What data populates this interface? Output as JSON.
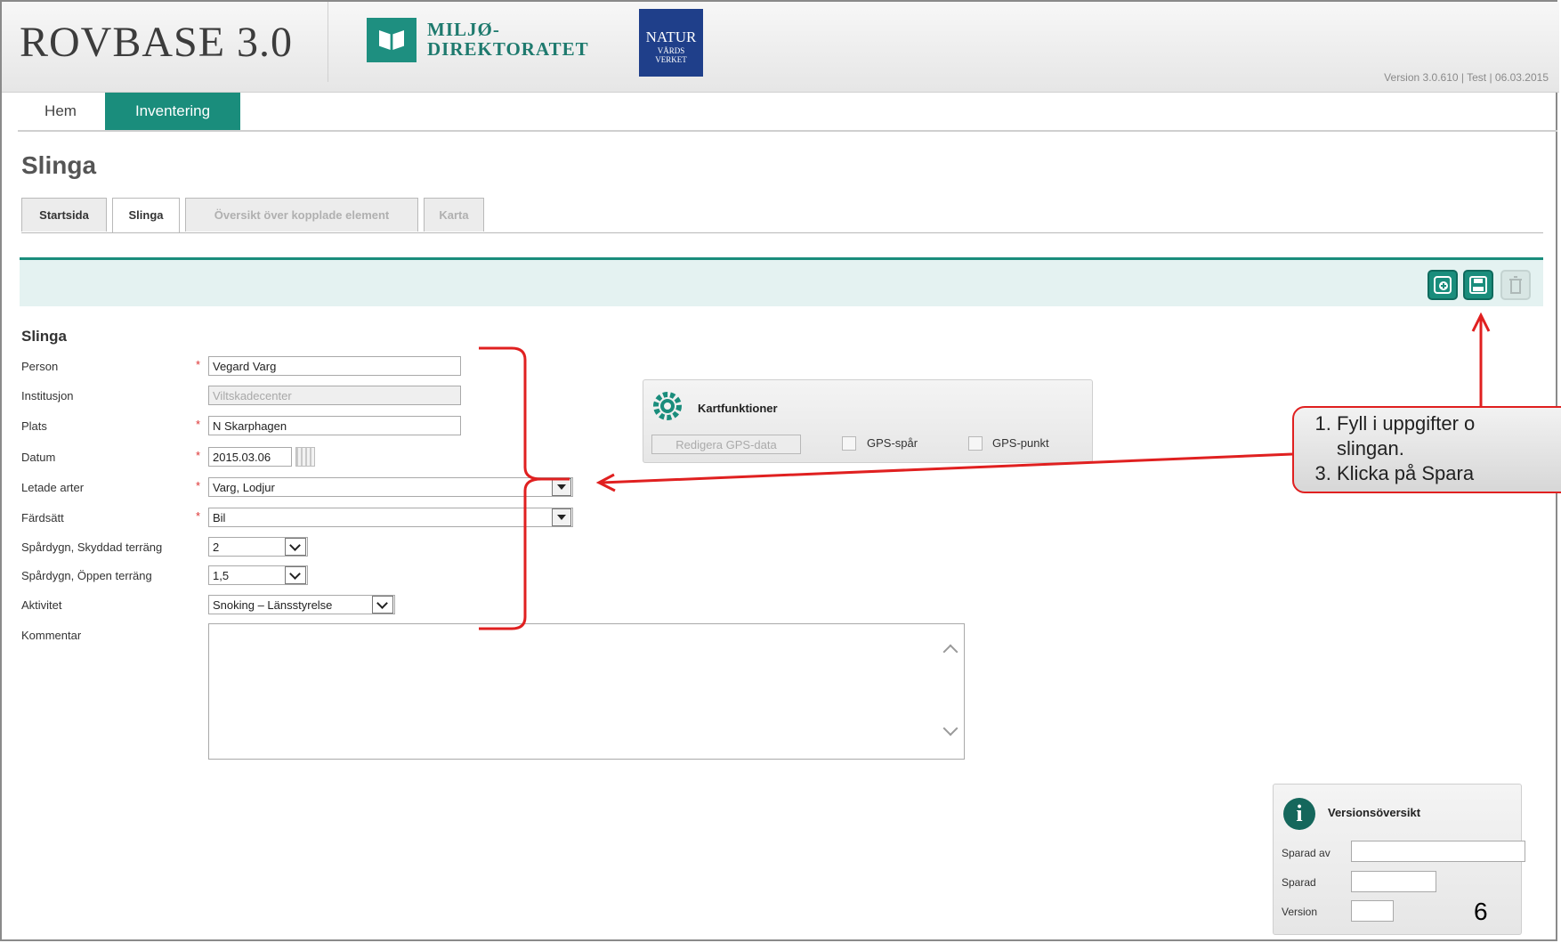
{
  "app": {
    "title": "ROVBASE 3.0",
    "logo_miljo_line1": "MILJØ-",
    "logo_miljo_line2": "DIREKTORATET",
    "logo_nv_line1": "NATUR",
    "logo_nv_line2": "VÅRDS",
    "logo_nv_line3": "VERKET",
    "version_info": "Version 3.0.610 | Test | 06.03.2015"
  },
  "nav": {
    "home": "Hem",
    "inventory": "Inventering"
  },
  "page": {
    "title": "Slinga"
  },
  "tabs": [
    {
      "label": "Startsida",
      "state": "normal"
    },
    {
      "label": "Slinga",
      "state": "active"
    },
    {
      "label": "Översikt över kopplade element",
      "state": "disabled"
    },
    {
      "label": "Karta",
      "state": "disabled"
    }
  ],
  "toolbar": {
    "icons": [
      "new-icon",
      "save-icon",
      "delete-icon"
    ]
  },
  "form": {
    "section_title": "Slinga",
    "required_mark": "*",
    "person_label": "Person",
    "person_value": "Vegard Varg",
    "institution_label": "Institusjon",
    "institution_value": "Viltskadecenter",
    "plats_label": "Plats",
    "plats_value": "N Skarphagen",
    "datum_label": "Datum",
    "datum_value": "2015.03.06",
    "arter_label": "Letade arter",
    "arter_value": "Varg, Lodjur",
    "fardsatt_label": "Färdsätt",
    "fardsatt_value": "Bil",
    "skyddad_label": "Spårdygn, Skyddad terräng",
    "skyddad_value": "2",
    "oppen_label": "Spårdygn, Öppen terräng",
    "oppen_value": "1,5",
    "aktivitet_label": "Aktivitet",
    "aktivitet_value": "Snoking – Länsstyrelse",
    "kommentar_label": "Kommentar",
    "kommentar_value": ""
  },
  "kartfunktioner": {
    "title": "Kartfunktioner",
    "edit_gps_button": "Redigera GPS-data",
    "gps_spar_label": "GPS-spår",
    "gps_punkt_label": "GPS-punkt"
  },
  "versionsoversikt": {
    "title": "Versionsöversikt",
    "sparad_av_label": "Sparad av",
    "sparad_label": "Sparad",
    "version_label": "Version"
  },
  "callout": {
    "steps": [
      "Fyll i uppgifter o",
      "slingan.",
      "Klicka på Spara"
    ]
  },
  "slide_number": "6",
  "colors": {
    "accent": "#1a8d7c",
    "required": "#dd3333",
    "annotation": "#e02020"
  }
}
